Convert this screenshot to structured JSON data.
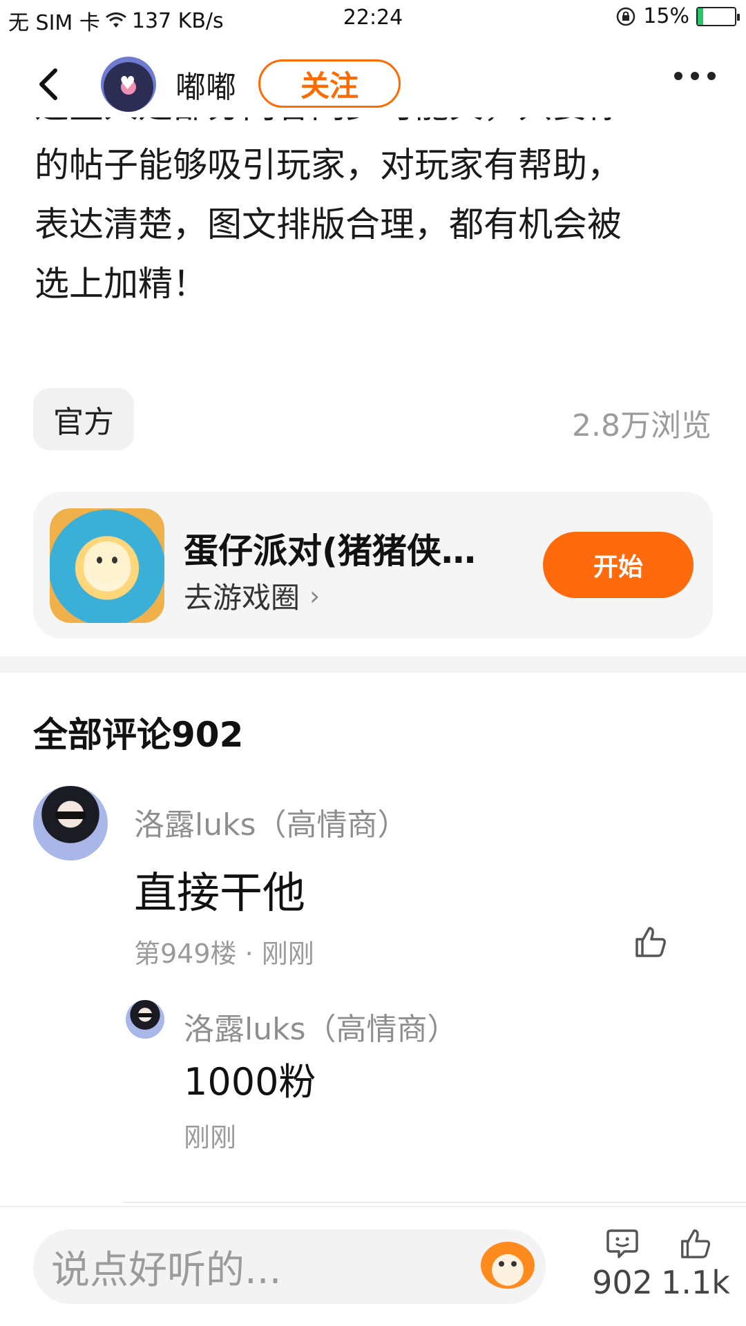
{
  "status_bar": {
    "carrier": "无 SIM 卡",
    "speed": "137 KB/s",
    "time": "22:24",
    "battery": "15%",
    "battery_level": 0.15,
    "battery_color": "#2cc46a"
  },
  "nav": {
    "back_icon": "chevron-left-icon",
    "username": "嘟嘟",
    "follow_label": "关注",
    "more_icon": "more-dots-icon",
    "accent": "#ff6a00"
  },
  "article": {
    "lines": [
      "这些人是部分内容同步可能关，只要你",
      "的帖子能够吸引玩家，对玩家有帮助，",
      "表达清楚，图文排版合理，都有机会被",
      "选上加精！"
    ]
  },
  "meta": {
    "tag": "官方",
    "views": "2.8万浏览"
  },
  "game_card": {
    "title": "蛋仔派对(猪猪侠…",
    "subtitle": "去游戏圈",
    "button": "开始"
  },
  "comments": {
    "title": "全部评论902",
    "items": [
      {
        "author": "洛露luks（高情商）",
        "text": "直接干他",
        "meta": "第949楼 · 刚刚",
        "reply": {
          "author": "洛露luks（高情商）",
          "text": "1000粉",
          "time": "刚刚"
        }
      }
    ]
  },
  "bottom_bar": {
    "placeholder": "说点好听的...",
    "comment_count": "902",
    "like_count": "1.1k"
  }
}
